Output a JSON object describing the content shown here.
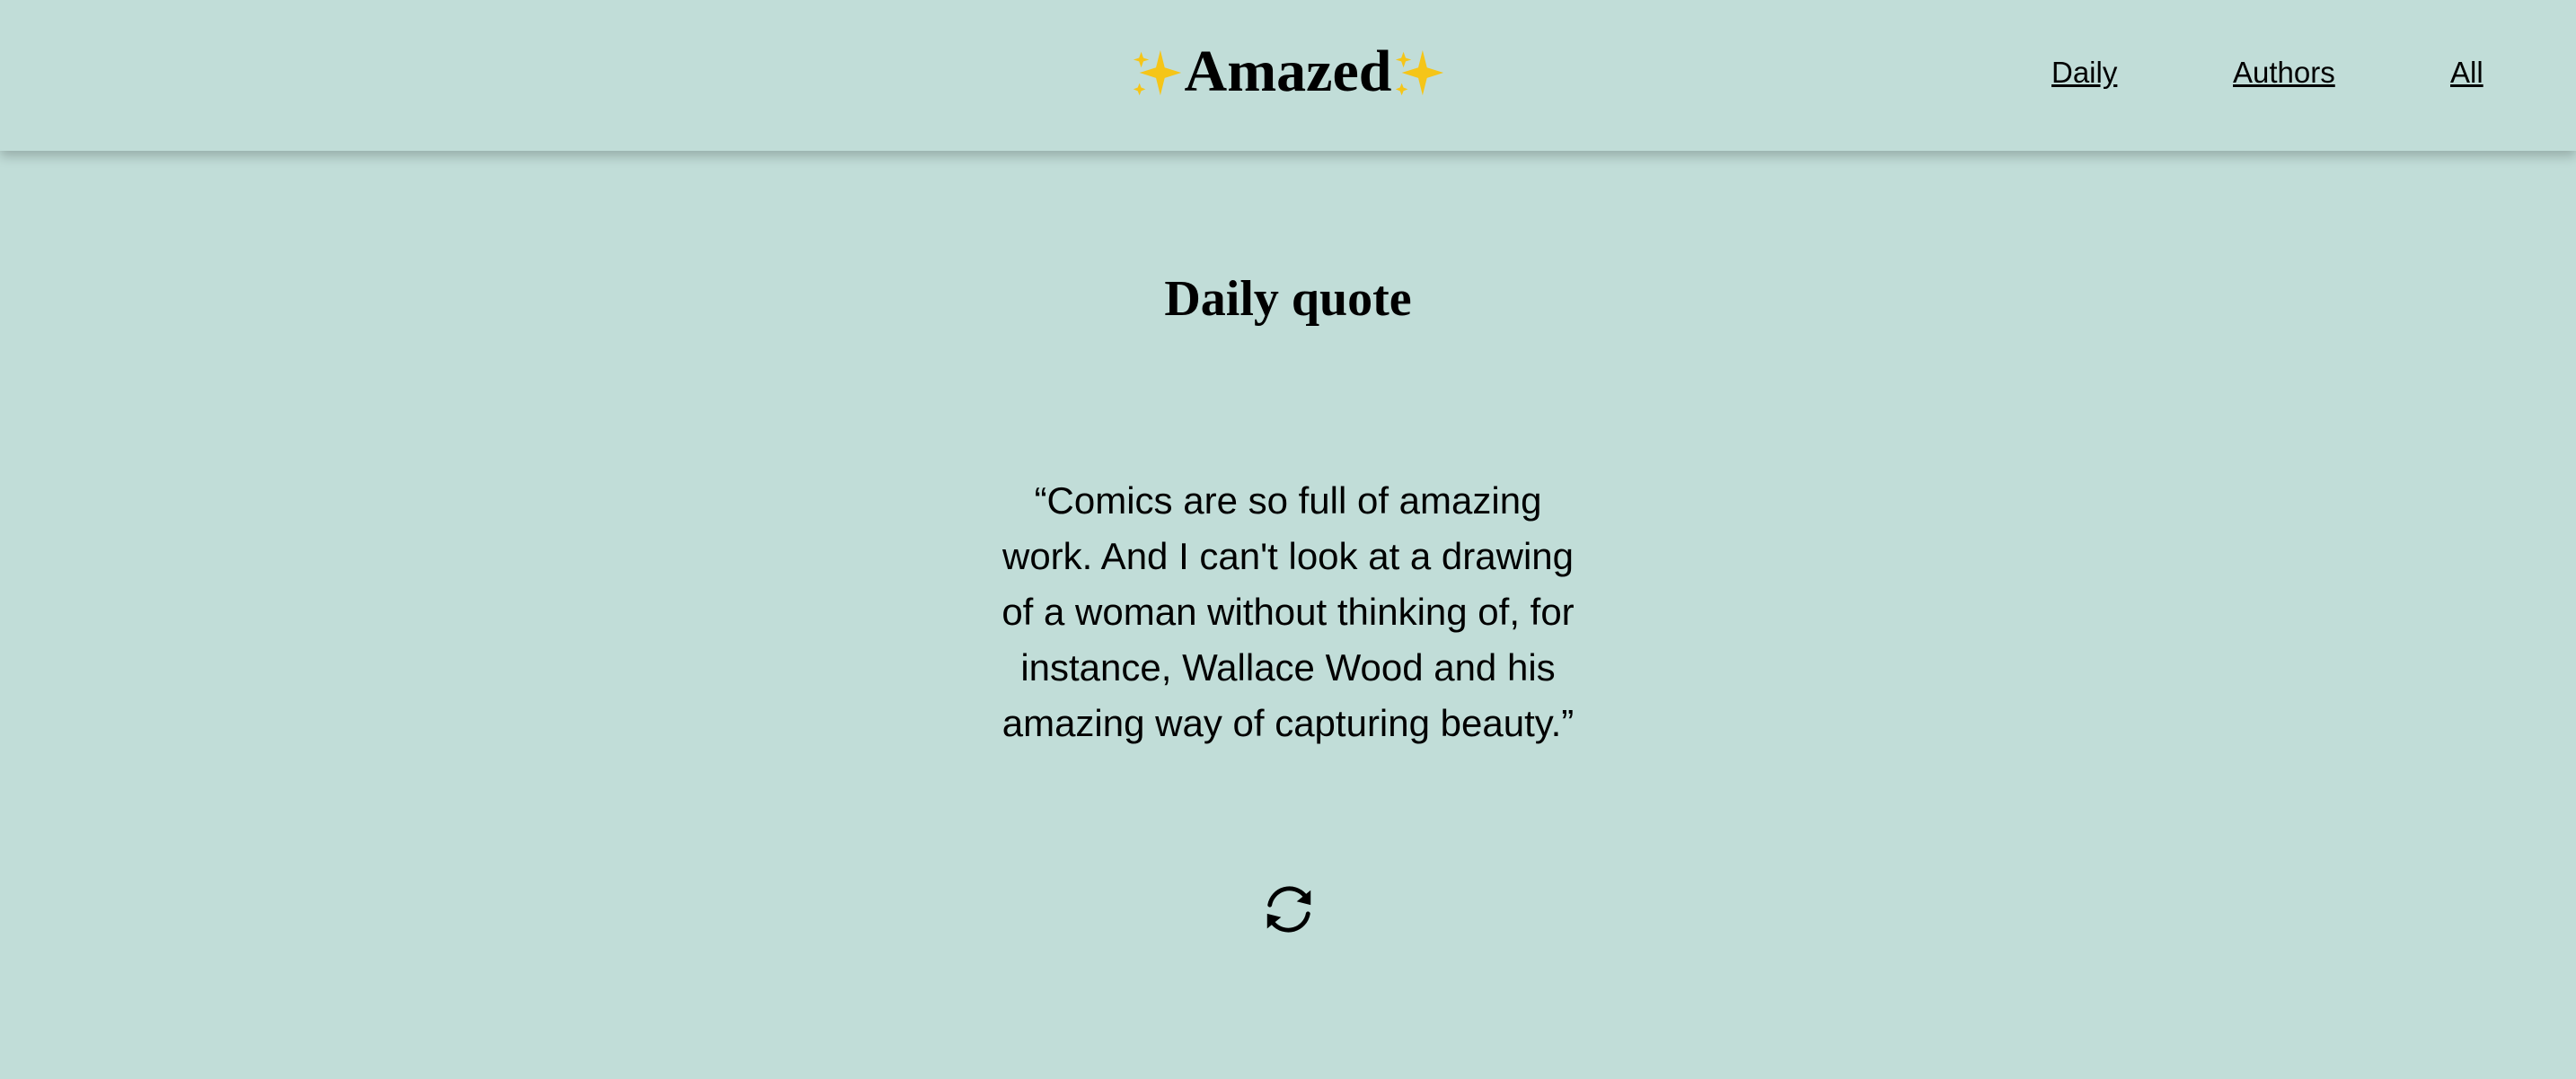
{
  "header": {
    "logo_text": "Amazed",
    "logo_icon": "sparkles-icon",
    "nav": [
      {
        "label": "Daily"
      },
      {
        "label": "Authors"
      },
      {
        "label": "All"
      }
    ]
  },
  "main": {
    "title": "Daily quote",
    "quote": "“Comics are so full of amazing work. And I can't look at a drawing of a woman without thinking of, for instance, Wallace Wood and his amazing way of capturing beauty.”",
    "refresh_icon": "refresh-icon"
  },
  "colors": {
    "background": "#c1ddd8",
    "sparkle": "#f5c518"
  }
}
